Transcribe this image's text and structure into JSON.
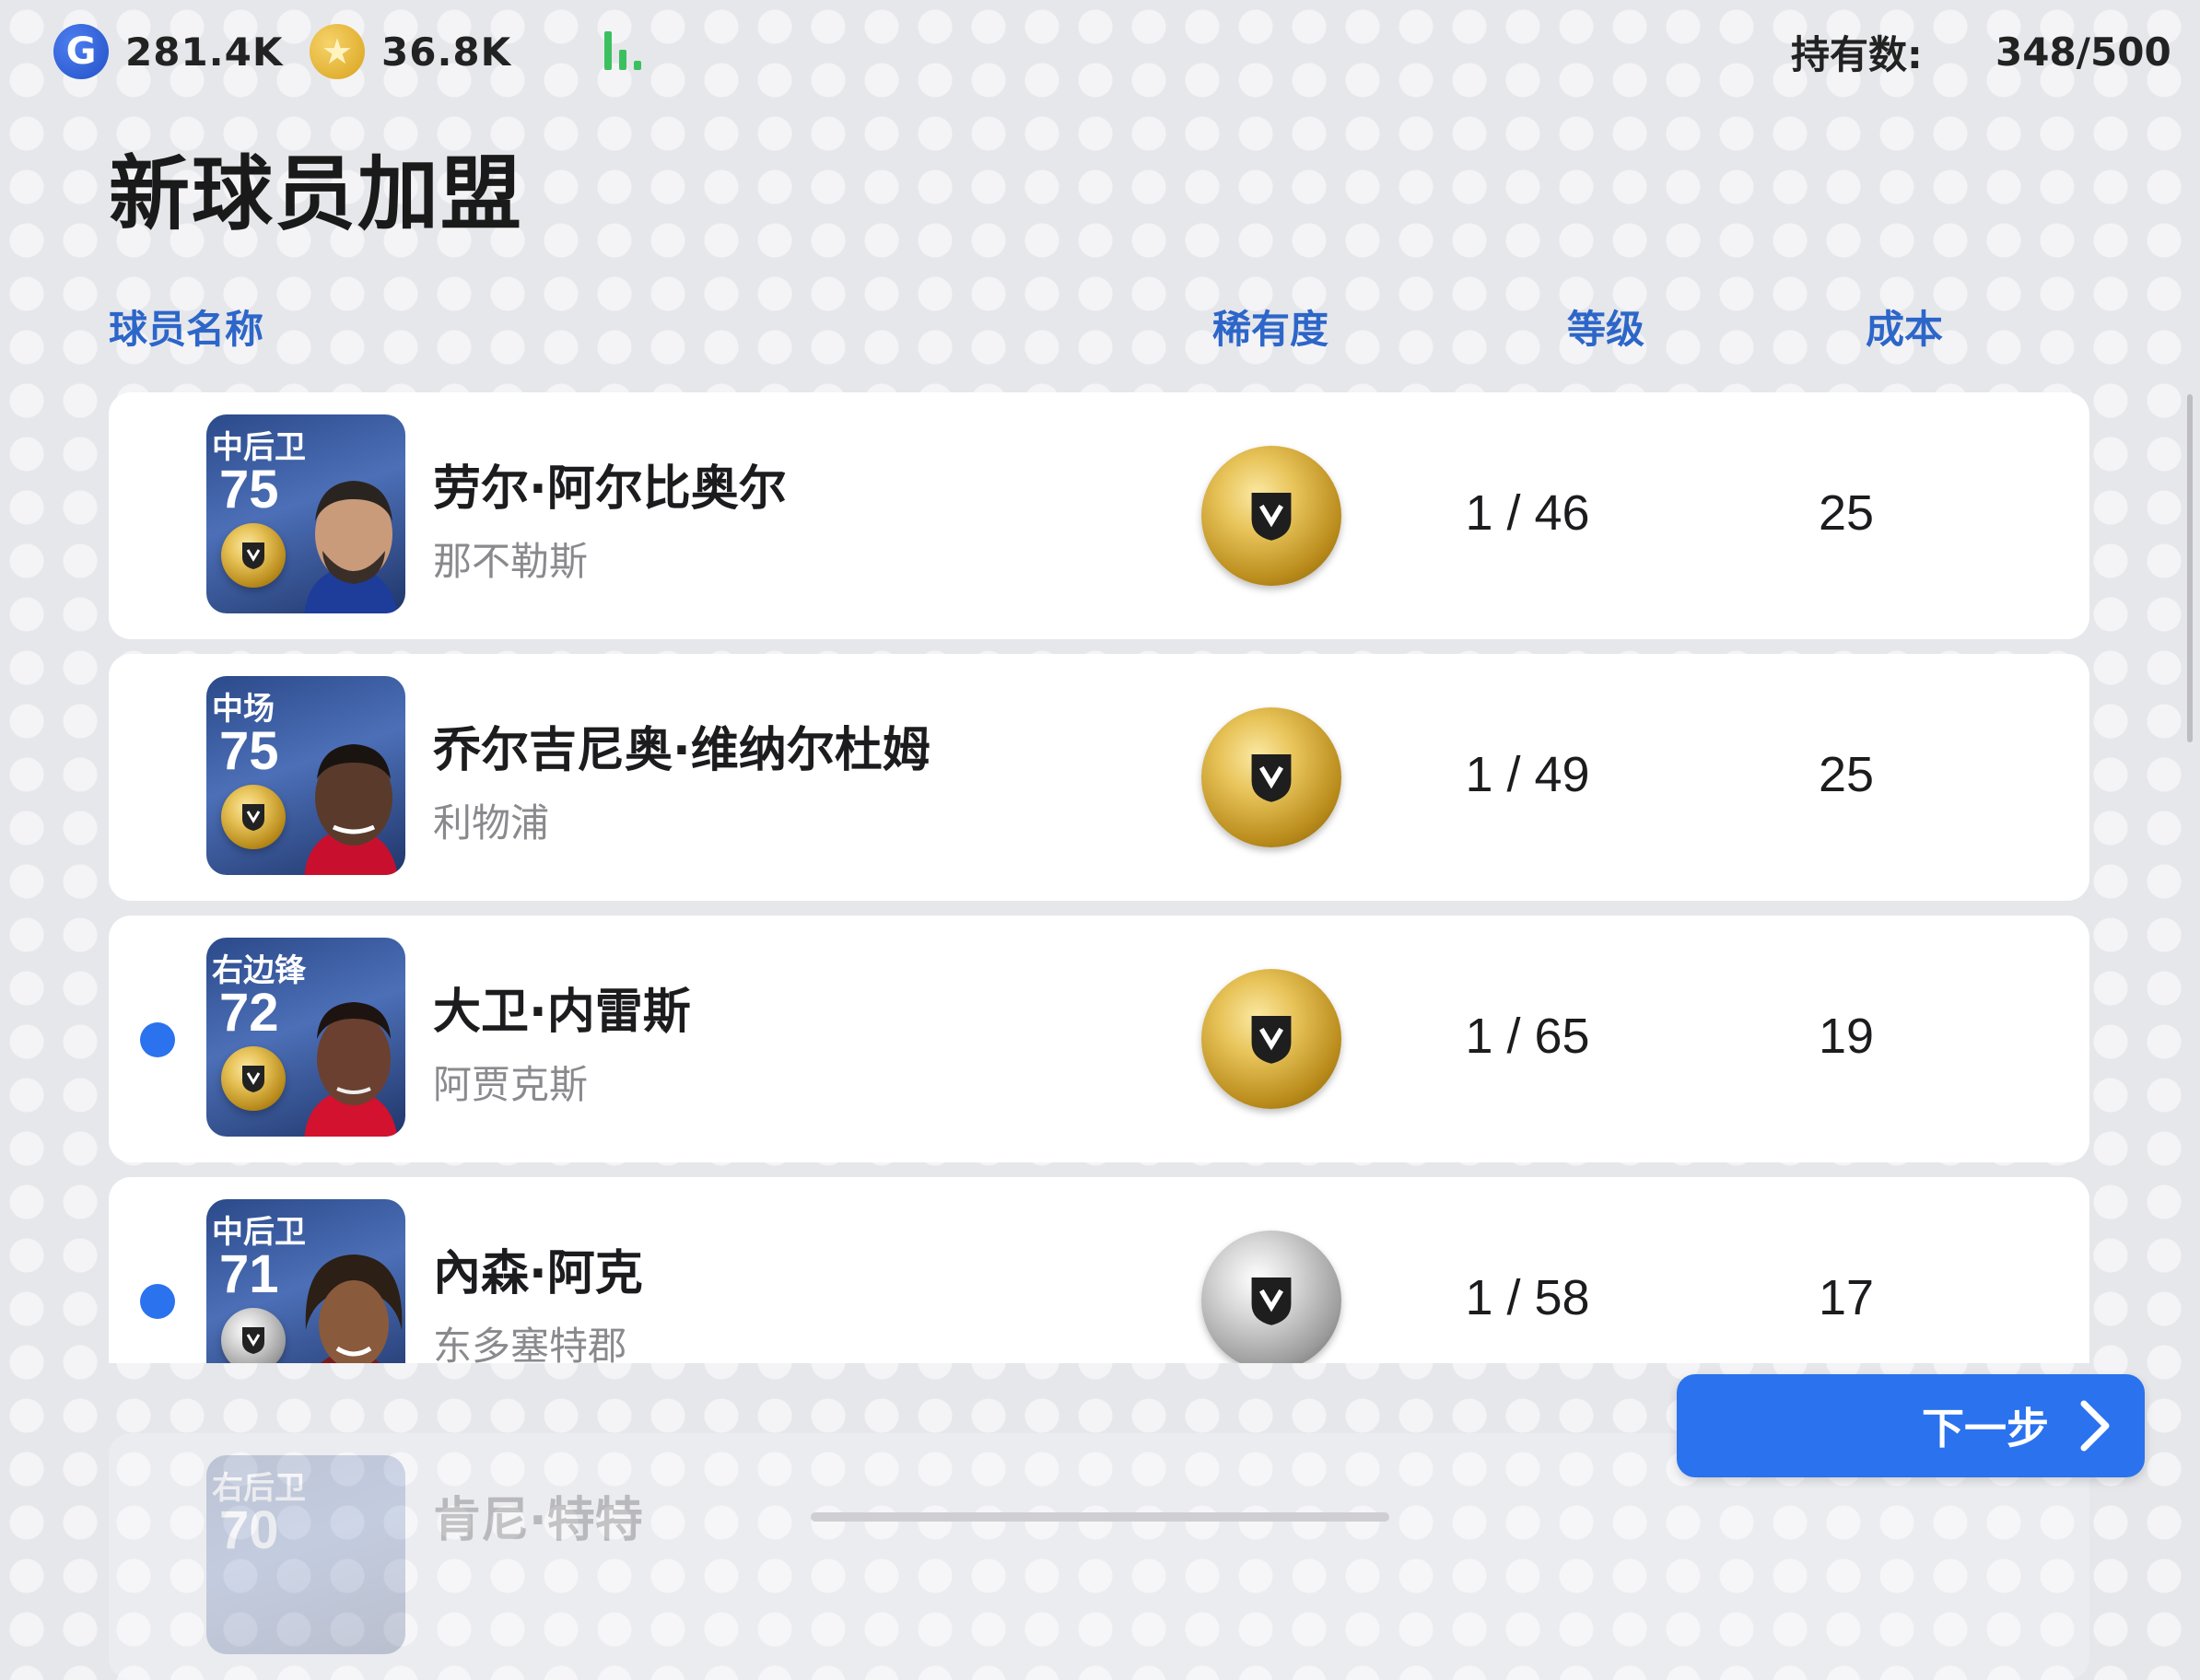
{
  "topbar": {
    "gp_icon": "g-coin-icon",
    "gp_icon_glyph": "G",
    "gp_value": "281.4K",
    "coin_icon": "star-coin-icon",
    "coin_icon_glyph": "★",
    "coin_value": "36.8K",
    "signal_icon": "signal-bars-icon",
    "owned_label": "持有数:",
    "owned_value": "348/500"
  },
  "title": "新球员加盟",
  "columns": {
    "name": "球员名称",
    "rarity": "稀有度",
    "level": "等级",
    "cost": "成本"
  },
  "players": [
    {
      "position": "中后卫",
      "rating": "75",
      "name": "劳尔·阿尔比奥尔",
      "club": "那不勒斯",
      "rarity": "gold",
      "level": "1 / 46",
      "cost": "25",
      "new": false
    },
    {
      "position": "中场",
      "rating": "75",
      "name": "乔尔吉尼奥·维纳尔杜姆",
      "club": "利物浦",
      "rarity": "gold",
      "level": "1 / 49",
      "cost": "25",
      "new": false
    },
    {
      "position": "右边锋",
      "rating": "72",
      "name": "大卫·内雷斯",
      "club": "阿贾克斯",
      "rarity": "gold",
      "level": "1 / 65",
      "cost": "19",
      "new": true
    },
    {
      "position": "中后卫",
      "rating": "71",
      "name": "內森·阿克",
      "club": "东多塞特郡",
      "rarity": "silver",
      "level": "1 / 58",
      "cost": "17",
      "new": true
    }
  ],
  "partial_row": {
    "position": "右后卫",
    "rating": "70",
    "name": "肯尼·特特"
  },
  "next_button": {
    "label": "下一步",
    "icon": "chevron-right-icon"
  },
  "colors": {
    "accent": "#2a72ee",
    "header_text": "#2d66c9",
    "gold": "#d9a21b",
    "silver": "#9c9c9c",
    "signal": "#3cc05f"
  }
}
